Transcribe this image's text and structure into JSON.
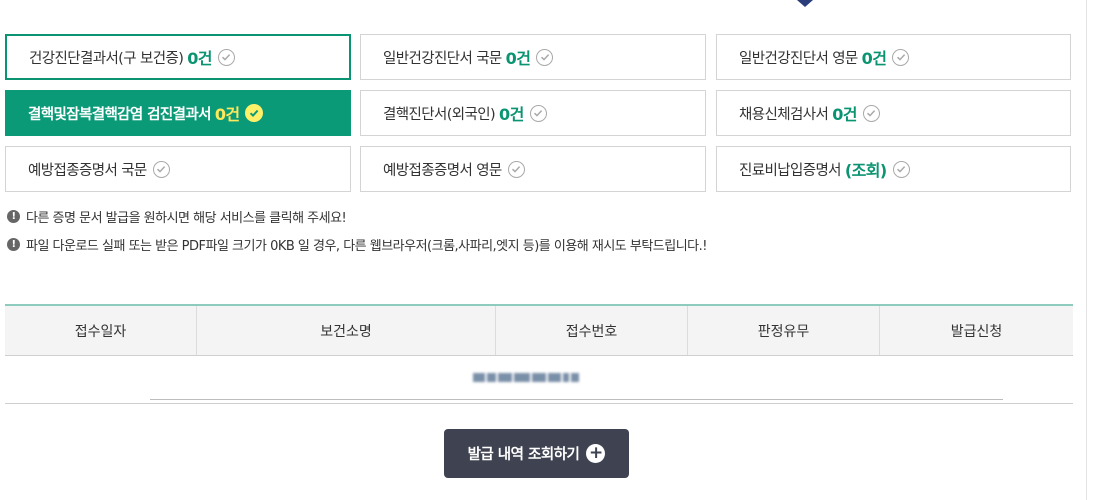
{
  "certificates": [
    {
      "label": "건강진단결과서(구 보건증)",
      "count": "0건",
      "state": "outlined"
    },
    {
      "label": "일반건강진단서 국문",
      "count": "0건",
      "state": "normal"
    },
    {
      "label": "일반건강진단서 영문",
      "count": "0건",
      "state": "normal"
    },
    {
      "label": "결핵및잠복결핵감염 검진결과서",
      "count": "0건",
      "state": "active"
    },
    {
      "label": "결핵진단서(외국인)",
      "count": "0건",
      "state": "normal"
    },
    {
      "label": "채용신체검사서",
      "count": "0건",
      "state": "normal"
    },
    {
      "label": "예방접종증명서 국문",
      "count": "",
      "state": "normal"
    },
    {
      "label": "예방접종증명서 영문",
      "count": "",
      "state": "normal"
    },
    {
      "label": "진료비납입증명서",
      "paren": "(조회)",
      "state": "normal"
    }
  ],
  "notices": [
    "다른 증명 문서 발급을 원하시면 해당 서비스를 클릭해 주세요!",
    "파일 다운로드 실패 또는 받은 PDF파일 크기가 0KB 일 경우, 다른 웹브라우저(크롬,사파리,엣지 등)를 이용해 재시도 부탁드립니다.!"
  ],
  "table": {
    "headers": [
      "접수일자",
      "보건소명",
      "접수번호",
      "판정유무",
      "발급신청"
    ]
  },
  "button": {
    "label": "발급 내역 조회하기",
    "icon": "plus-circle-icon"
  },
  "colors": {
    "accent": "#0b9a78",
    "highlight": "#ffe85a",
    "button": "#3e4251"
  }
}
